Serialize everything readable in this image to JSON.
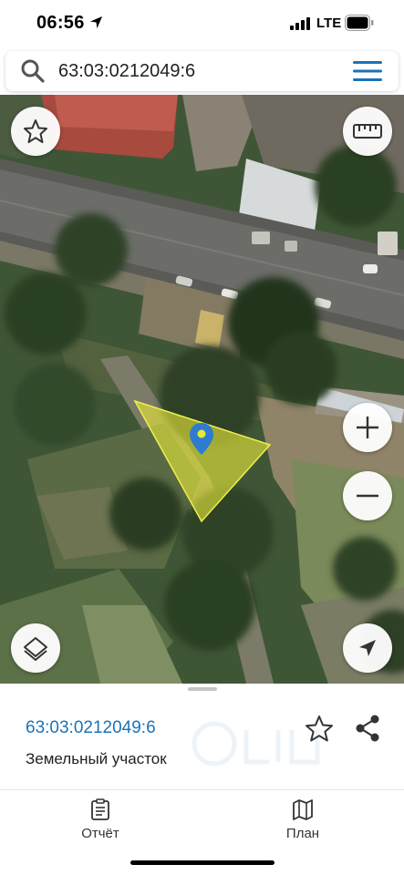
{
  "status_bar": {
    "time": "06:56",
    "network": "LTE",
    "location_icon": "location-arrow-icon",
    "signal_icon": "cellular-signal-icon",
    "battery_icon": "battery-icon"
  },
  "search": {
    "value": "63:03:0212049:6",
    "search_icon": "search-icon",
    "menu_icon": "hamburger-menu-icon"
  },
  "map": {
    "type": "satellite",
    "highlight_color": "#e6e83a",
    "marker_color": "#2f7bd0",
    "controls": {
      "favorite_icon": "star-icon",
      "ruler_icon": "ruler-icon",
      "zoom_in_icon": "plus-icon",
      "zoom_out_icon": "minus-icon",
      "layers_icon": "layers-icon",
      "locate_icon": "navigation-arrow-icon"
    }
  },
  "sheet": {
    "parcel_id": "63:03:0212049:6",
    "parcel_type": "Земельный участок",
    "favorite_icon": "star-outline-icon",
    "share_icon": "share-icon",
    "accent_color": "#1a73b8",
    "tabs": [
      {
        "label": "Отчёт",
        "icon": "clipboard-icon"
      },
      {
        "label": "План",
        "icon": "map-icon"
      }
    ]
  }
}
